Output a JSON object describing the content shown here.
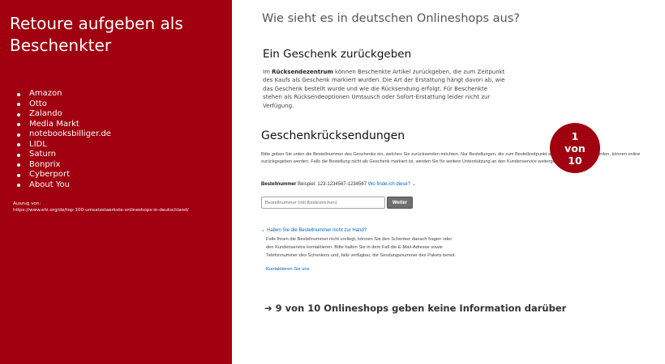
{
  "left": {
    "title": "Retoure aufgeben als Beschenkter",
    "shops": [
      "Amazon",
      "Otto",
      "Zalando",
      "Media Markt",
      "notebooksbilliger.de",
      "LIDL",
      "Saturn",
      "Bonprix",
      "Cyberport",
      "About You"
    ],
    "source_label": "Auszug von:",
    "source_url": "https://www.ehi.org/de/top-100-umsatzstaerkste-onlineshops-in-deutschland/",
    "background_color": "#a0000f"
  },
  "right": {
    "question": "Wie sieht es in deutschen Onlineshops aus?",
    "counter": {
      "current": "1",
      "word": "von",
      "total": "10"
    },
    "conclusion": "9 von 10 Onlineshops geben keine Information darüber",
    "conclusion_icon": "arrow-right-icon"
  },
  "screenshot": {
    "gift_heading": "Ein Geschenk zurückgeben",
    "gift_para_prefix": "Im ",
    "gift_para_bold": "Rücksendezentrum",
    "gift_para_rest": " können Beschenkte Artikel zurückgeben, die zum Zeitpunkt des Kaufs als Geschenk markiert wurden. Die Art der Erstattung hängt davon ab, wie das Geschenk bestellt wurde und wie die Rücksendung erfolgt. Für Beschenkte stehen als Rücksendeoptionen Umtausch oder Sofort-Erstattung leider nicht zur Verfügung.",
    "returns_heading": "Geschenkrücksendungen",
    "instructions": "Bitte geben Sie unten die Bestellnummer des Geschenks ein, welches Sie zurücksenden möchten. Nur Bestellungen, die zum Bestellzeitpunkt als Geschenk markiert wurden, können online zurückgegeben werden. Falls die Bestellung nicht als Geschenk markiert ist, werden Sie für weitere Unterstützung an den Kundenservice weitergeleitet.",
    "order_label": "Bestellnummer",
    "order_example": "Beispiel: 123-1234567-1234567",
    "order_help_link": "Wo finde ich diese?",
    "order_placeholder": "Bestellnummer (mit Bindestrichen)",
    "continue_button": "Weiter",
    "hint_toggle": "Haben Sie die Bestellnummer nicht zur Hand?",
    "hint_text": "Falls Ihnen die Bestellnummer nicht vorliegt, können Sie den Schenker danach fragen oder den Kundenservice kontaktieren. Bitte halten Sie in dem Fall die E-Mail-Adresse sowie Telefonnummer des Schenkers und, falls verfügbar, die Sendungsnummer des Pakets bereit.",
    "contact_link": "Kontaktieren Sie uns",
    "link_color": "#0066c0"
  }
}
